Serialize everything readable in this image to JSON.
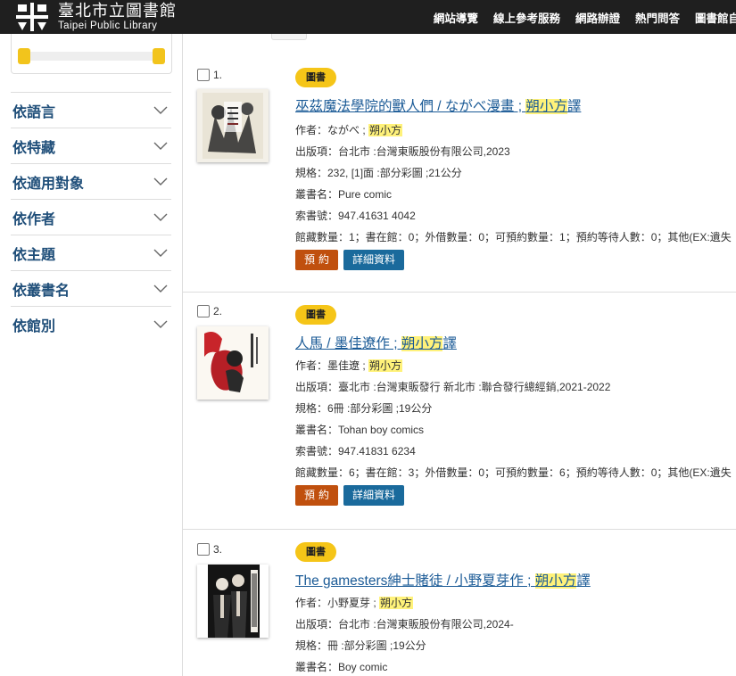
{
  "header": {
    "logo_zh": "臺北市立圖書館",
    "logo_en": "Taipei Public Library",
    "nav": [
      "網站導覽",
      "線上參考服務",
      "網路辦證",
      "熱門問答",
      "圖書館自"
    ]
  },
  "sidebar": {
    "facets": [
      "依語言",
      "依特藏",
      "依適用對象",
      "依作者",
      "依主題",
      "依叢書名",
      "依館別"
    ]
  },
  "results": [
    {
      "index": "1.",
      "badge": "圖書",
      "title_main": "巫茲魔法學院的獸人們 / ながべ漫畫 ; ",
      "title_hl": "朔小方",
      "title_tail": "譯",
      "author_label": "作者：",
      "author": "ながべ ; ",
      "author_hl": "朔小方",
      "publication": "出版項：台北市 :台灣東販股份有限公司,2023",
      "format": "規格：232, [1]面 :部分彩圖 ;21公分",
      "series": "叢書名：Pure comic",
      "callno": "索書號：947.41631 4042",
      "holdings": "館藏數量：1；書在館：0；外借數量：0；可預約數量：1；預約等待人數：0；其他(EX:遺失",
      "reserve_label": "預約",
      "detail_label": "詳細資料"
    },
    {
      "index": "2.",
      "badge": "圖書",
      "title_main": "人馬 / 墨佳遼作 ; ",
      "title_hl": "朔小方",
      "title_tail": "譯",
      "author_label": "作者：",
      "author": "墨佳遼 ; ",
      "author_hl": "朔小方",
      "publication": "出版項：臺北市 :台灣東販發行 新北市 :聯合發行總經銷,2021-2022",
      "format": "規格：6冊 :部分彩圖 ;19公分",
      "series": "叢書名：Tohan boy comics",
      "callno": "索書號：947.41831 6234",
      "holdings": "館藏數量：6；書在館：3；外借數量：0；可預約數量：6；預約等待人數：0；其他(EX:遺失",
      "reserve_label": "預約",
      "detail_label": "詳細資料"
    },
    {
      "index": "3.",
      "badge": "圖書",
      "title_main": "The gamesters紳士賭徒 / 小野夏芽作 ; ",
      "title_hl": "朔小方",
      "title_tail": "譯",
      "author_label": "作者：",
      "author": "小野夏芽 ; ",
      "author_hl": "朔小方",
      "publication": "出版項：台北市 :台灣東販股份有限公司,2024-",
      "format": "規格：冊 :部分彩圖 ;19公分",
      "series": "叢書名：Boy comic"
    }
  ],
  "colors": {
    "header_bg": "#1f1f1f",
    "badge": "#f5c518",
    "highlight": "#fff27a",
    "link": "#1a5a96",
    "reserve_button": "#c0500e",
    "detail_button": "#1a6a9c"
  }
}
